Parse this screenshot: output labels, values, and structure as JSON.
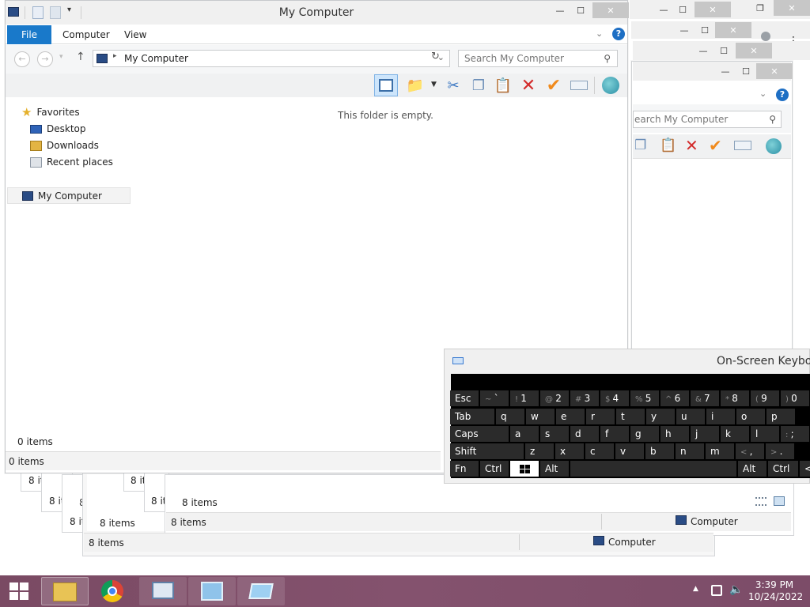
{
  "main_window": {
    "title": "My Computer",
    "ribbon_tabs": [
      "File",
      "Computer",
      "View"
    ],
    "address_path": "My Computer",
    "search_placeholder": "Search My Computer",
    "empty_message": "This folder is empty.",
    "nav": {
      "favorites": "Favorites",
      "desktop": "Desktop",
      "downloads": "Downloads",
      "recent": "Recent places",
      "computer": "My Computer"
    },
    "pane_status": "0 items",
    "status": "0 items"
  },
  "back_windows": {
    "search_placeholder": "earch My Computer",
    "stack_items": [
      "8 it",
      "8 it",
      "8 it",
      "8 it",
      "8 it",
      "8 it",
      "8 it"
    ],
    "count_front": "8 items",
    "count_back": "8 items",
    "status_mid": "8 items",
    "status_back": "8 items",
    "location_mid": "Computer",
    "location_back": "Computer"
  },
  "keyboard": {
    "title": "On-Screen Keyboa",
    "row1": [
      "Esc",
      "~ `",
      "! 1",
      "@ 2",
      "# 3",
      "$ 4",
      "% 5",
      "^ 6",
      "& 7",
      "* 8",
      "( 9",
      ") 0"
    ],
    "row2": [
      "Tab",
      "q",
      "w",
      "e",
      "r",
      "t",
      "y",
      "u",
      "i",
      "o",
      "p"
    ],
    "row3": [
      "Caps",
      "a",
      "s",
      "d",
      "f",
      "g",
      "h",
      "j",
      "k",
      "l",
      ": ;"
    ],
    "row4": [
      "Shift",
      "z",
      "x",
      "c",
      "v",
      "b",
      "n",
      "m",
      "< ,",
      "> ."
    ],
    "row5": [
      "Fn",
      "Ctrl",
      "Alt",
      "Alt",
      "Ctrl",
      "<"
    ]
  },
  "taskbar": {
    "time": "3:39 PM",
    "date": "10/24/2022"
  },
  "colors": {
    "accent": "#1979ca",
    "taskbar": "#7e4e69"
  }
}
